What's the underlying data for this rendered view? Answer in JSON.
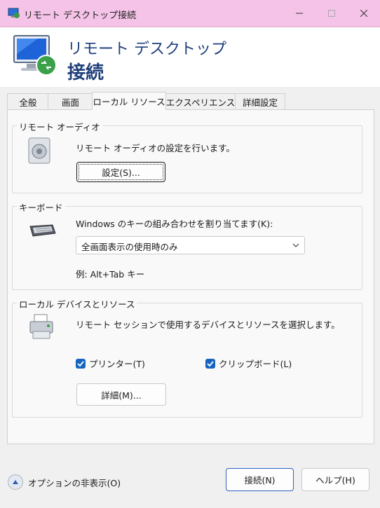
{
  "window": {
    "title": "リモート デスクトップ接続",
    "minimize_icon": "minimize-icon",
    "maximize_icon": "maximize-icon",
    "close_icon": "close-icon"
  },
  "banner": {
    "line1": "リモート デスクトップ",
    "line2": "接続",
    "icon": "remote-desktop-monitor-icon"
  },
  "tabs": [
    {
      "label": "全般",
      "active": false
    },
    {
      "label": "画面",
      "active": false
    },
    {
      "label": "ローカル リソース",
      "active": true
    },
    {
      "label": "エクスペリエンス",
      "active": false
    },
    {
      "label": "詳細設定",
      "active": false
    }
  ],
  "audio": {
    "group_label": "リモート オーディオ",
    "description": "リモート オーディオの設定を行います。",
    "settings_button": "設定(S)...",
    "icon": "speaker-icon"
  },
  "keyboard": {
    "group_label": "キーボード",
    "description": "Windows のキーの組み合わせを割り当てます(K):",
    "selected_option": "全画面表示の使用時のみ",
    "example": "例: Alt+Tab キー",
    "icon": "keyboard-icon"
  },
  "devices": {
    "group_label": "ローカル デバイスとリソース",
    "description": "リモート セッションで使用するデバイスとリソースを選択します。",
    "printers_label": "プリンター(T)",
    "printers_checked": true,
    "clipboard_label": "クリップボード(L)",
    "clipboard_checked": true,
    "details_button": "詳細(M)...",
    "icon": "printer-icon"
  },
  "footer": {
    "hide_options": "オプションの非表示(O)",
    "connect_button": "接続(N)",
    "help_button": "ヘルプ(H)"
  },
  "colors": {
    "titlebar": "#f4c3e7",
    "banner_text": "#1f3f7a",
    "checkbox": "#1565c0"
  }
}
